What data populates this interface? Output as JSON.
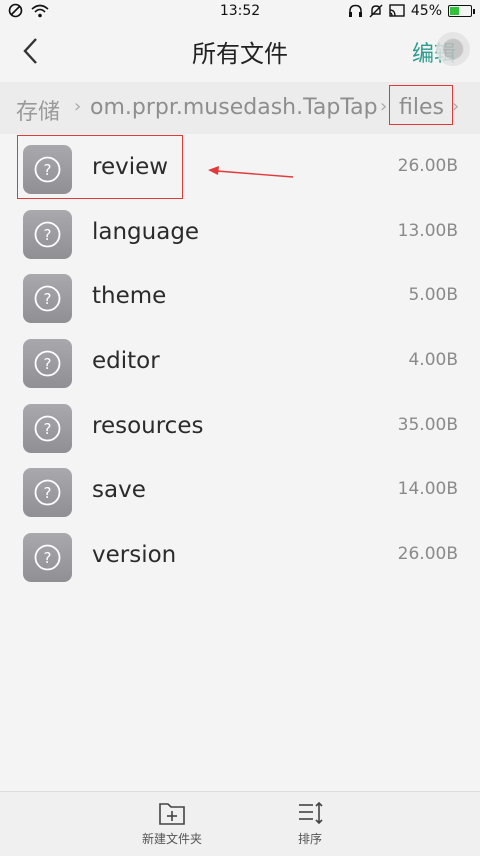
{
  "status_bar": {
    "time": "13:52",
    "battery_percent": "45%",
    "battery_level": 0.45,
    "icons": [
      "do-not-disturb-icon",
      "wifi-icon",
      "headset-icon",
      "mute-icon",
      "cast-icon",
      "battery-icon"
    ]
  },
  "header": {
    "title": "所有文件",
    "edit_label": "编辑"
  },
  "breadcrumb": {
    "root": "存储",
    "path": "om.prpr.musedash.TapTap",
    "current": "files"
  },
  "files": [
    {
      "name": "review",
      "size": "26.00B"
    },
    {
      "name": "language",
      "size": "13.00B"
    },
    {
      "name": "theme",
      "size": "5.00B"
    },
    {
      "name": "editor",
      "size": "4.00B"
    },
    {
      "name": "resources",
      "size": "35.00B"
    },
    {
      "name": "save",
      "size": "14.00B"
    },
    {
      "name": "version",
      "size": "26.00B"
    }
  ],
  "bottom_bar": {
    "new_folder_label": "新建文件夹",
    "sort_label": "排序"
  },
  "colors": {
    "accent": "#2a9d8f",
    "annotation_red": "#e23a3a"
  }
}
